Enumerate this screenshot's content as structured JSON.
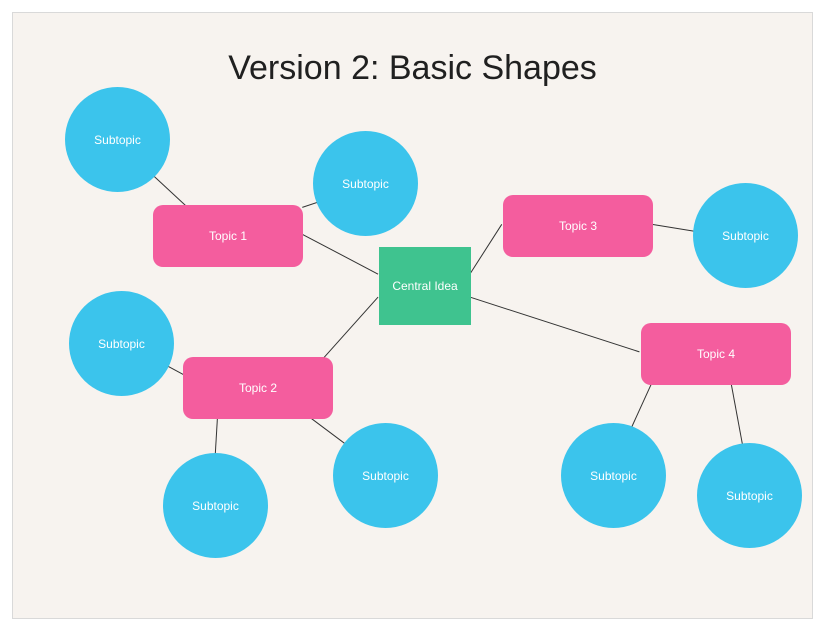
{
  "title": "Version 2: Basic Shapes",
  "central": {
    "label": "Central Idea"
  },
  "topics": {
    "t1": {
      "label": "Topic 1"
    },
    "t2": {
      "label": "Topic 2"
    },
    "t3": {
      "label": "Topic 3"
    },
    "t4": {
      "label": "Topic 4"
    }
  },
  "subtopics": {
    "s1": {
      "label": "Subtopic"
    },
    "s2": {
      "label": "Subtopic"
    },
    "s3": {
      "label": "Subtopic"
    },
    "s4": {
      "label": "Subtopic"
    },
    "s5": {
      "label": "Subtopic"
    },
    "s6": {
      "label": "Subtopic"
    },
    "s7": {
      "label": "Subtopic"
    },
    "s8": {
      "label": "Subtopic"
    }
  },
  "colors": {
    "central": "#3fc38f",
    "topic": "#f45d9e",
    "subtopic": "#3bc4ec",
    "background": "#f7f3ef"
  }
}
